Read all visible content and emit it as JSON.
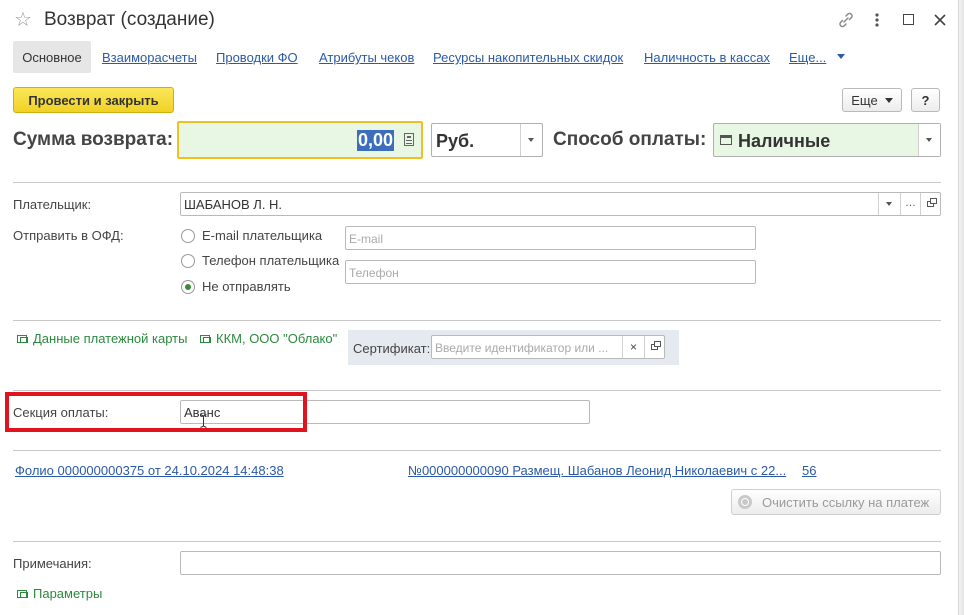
{
  "window": {
    "title": "Возврат (создание)"
  },
  "tabs": [
    {
      "label": "Основное",
      "active": true
    },
    {
      "label": "Взаиморасчеты"
    },
    {
      "label": "Проводки ФО"
    },
    {
      "label": "Атрибуты чеков"
    },
    {
      "label": "Ресурсы накопительных скидок"
    },
    {
      "label": "Наличность в кассах"
    },
    {
      "label": "Еще..."
    }
  ],
  "toolbar": {
    "post_close_label": "Провести и закрыть",
    "more_label": "Еще",
    "help_label": "?"
  },
  "amount": {
    "label": "Сумма возврата:",
    "value": "0,00",
    "currency": "Руб.",
    "payment_method_label": "Способ оплаты:",
    "payment_method": "Наличные"
  },
  "payer": {
    "label": "Плательщик:",
    "value": "ШАБАНОВ Л. Н."
  },
  "ofd": {
    "label": "Отправить в ОФД:",
    "options": [
      "E-mail плательщика",
      "Телефон плательщика",
      "Не отправлять"
    ],
    "selected": 2,
    "email_placeholder": "E-mail",
    "phone_placeholder": "Телефон"
  },
  "links": {
    "card_data": "Данные платежной карты",
    "kkm": "ККМ, ООО \"Облако\""
  },
  "certificate": {
    "label": "Сертификат:",
    "placeholder": "Введите идентификатор или ..."
  },
  "section": {
    "label": "Секция оплаты:",
    "value": "Аванс"
  },
  "folio": {
    "link": "Фолио 000000000375 от 24.10.2024 14:48:38",
    "placement_link": "№000000000090 Размещ. Шабанов Леонид Николаевич с 22...",
    "count": "56",
    "clear_button": "Очистить ссылку на платеж"
  },
  "notes": {
    "label": "Примечания:",
    "value": ""
  },
  "params_link": "Параметры",
  "colors": {
    "accent_yellow": "#f7e04a",
    "field_green": "#e8f7e4",
    "highlight_red": "#e0141e",
    "link_blue": "#2a5aa8",
    "link_green": "#2b8a3e"
  }
}
